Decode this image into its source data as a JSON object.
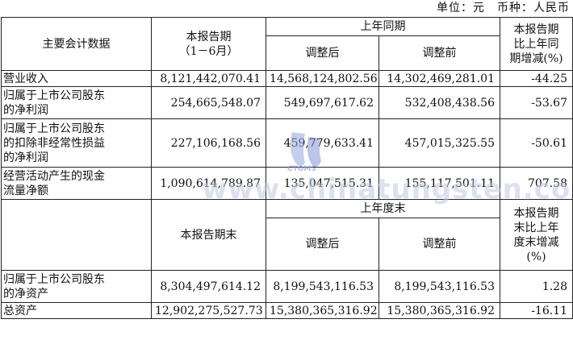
{
  "unit_line": "单位：元　币种：人民币",
  "watermark": {
    "text": "www.chinatungsten.com",
    "logo": "CTOMS",
    "color": "#bec8e1"
  },
  "income": {
    "header": {
      "label": "主要会计数据",
      "current": "本报告期\n（1－6月）",
      "prior": "上年同期",
      "adjusted_after": "调整后",
      "adjusted_before": "调整前",
      "change": "本报告期\n比上年同\n期增减(%)"
    },
    "rows": [
      {
        "label": "营业收入",
        "current": "8,121,442,070.41",
        "after": "14,568,124,802.56",
        "before": "14,302,469,281.01",
        "change": "-44.25"
      },
      {
        "label": "归属于上市公司股东\n的净利润",
        "current": "254,665,548.07",
        "after": "549,697,617.62",
        "before": "532,408,438.56",
        "change": "-53.67"
      },
      {
        "label": "归属于上市公司股东\n的扣除非经常性损益\n的净利润",
        "current": "227,106,168.56",
        "after": "459,779,633.41",
        "before": "457,015,325.55",
        "change": "-50.61"
      },
      {
        "label": "经营活动产生的现金\n流量净额",
        "current": "1,090,614,789.87",
        "after": "135,047,515.31",
        "before": "155,117,501.11",
        "change": "707.58"
      }
    ]
  },
  "balance": {
    "header": {
      "current": "本报告期末",
      "prior": "上年度末",
      "adjusted_after": "调整后",
      "adjusted_before": "调整前",
      "change": "本报告期\n末比上年\n度末增减\n(%)"
    },
    "rows": [
      {
        "label": "归属于上市公司股东\n的净资产",
        "current": "8,304,497,614.12",
        "after": "8,199,543,116.53",
        "before": "8,199,543,116.53",
        "change": "1.28"
      },
      {
        "label": "总资产",
        "current": "12,902,275,527.73",
        "after": "15,380,365,316.92",
        "before": "15,380,365,316.92",
        "change": "-16.11"
      }
    ]
  }
}
